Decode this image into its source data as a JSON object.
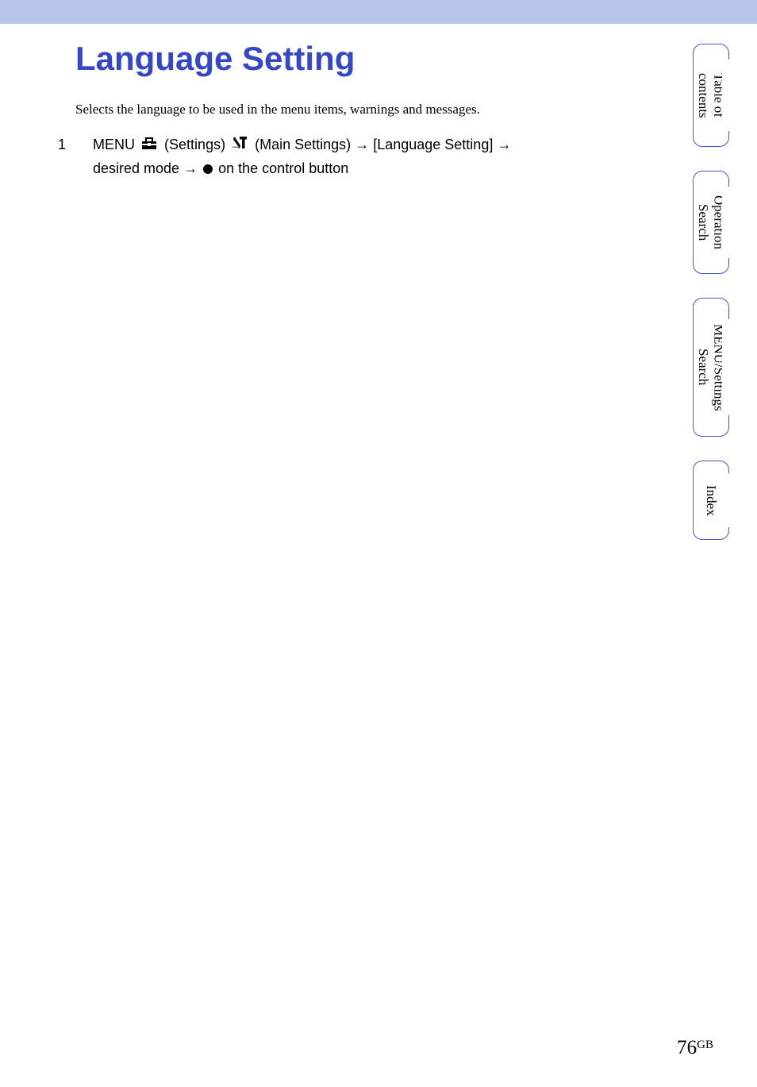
{
  "page": {
    "title": "Language Setting",
    "description": "Selects the language to be used in the menu items, warnings and messages.",
    "step": {
      "num": "1",
      "menu": "MENU",
      "arrow": "→",
      "settings_label": "(Settings)",
      "main_settings_label": "(Main Settings)",
      "language_setting": "[Language Setting]",
      "desired_mode": "desired mode",
      "on_control": "on the control button"
    }
  },
  "tabs": {
    "toc": "Table of\ncontents",
    "operation": "Operation\nSearch",
    "menu_settings": "MENU/Settings\nSearch",
    "index": "Index"
  },
  "footer": {
    "page_num": "76",
    "suffix": "GB"
  }
}
